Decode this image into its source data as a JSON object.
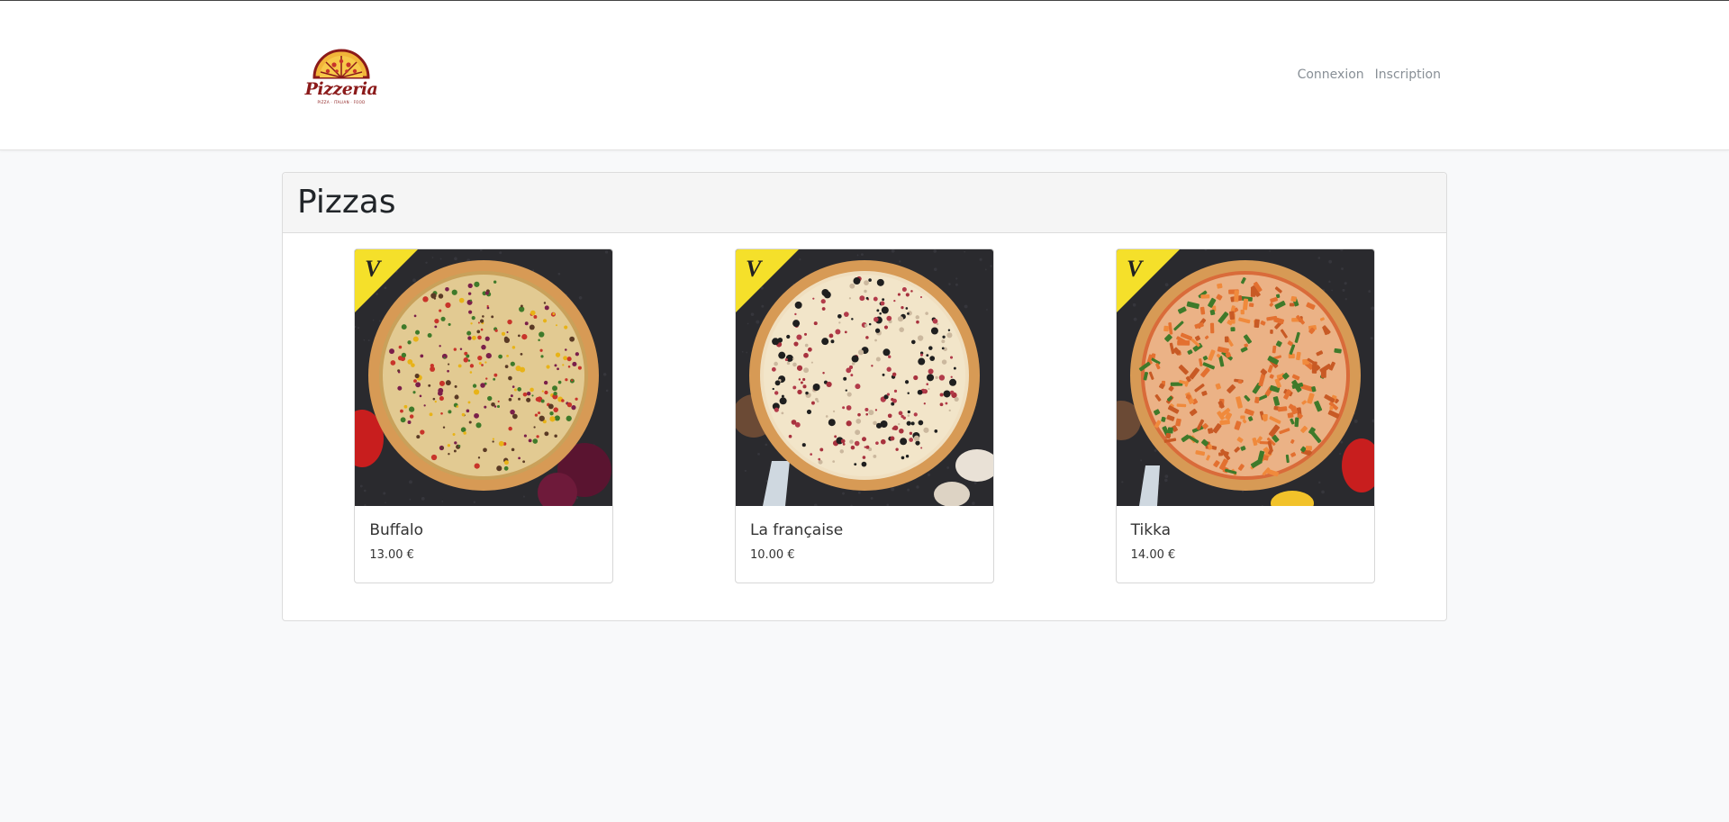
{
  "header": {
    "logo_text": "Pizzeria",
    "logo_sub": "PIZZA · ITALIAN · FOOD",
    "nav": [
      {
        "label": "Connexion"
      },
      {
        "label": "Inscription"
      }
    ]
  },
  "main": {
    "title": "Pizzas",
    "badge_letter": "V",
    "pizzas": [
      {
        "name": "Buffalo",
        "price": "13.00 €",
        "sauce": "#c9a15a",
        "cheese": "#e9d8a6",
        "toppings": [
          "#7a1f4a",
          "#e8b317",
          "#5a3a25",
          "#3f7a2a",
          "#c8342a"
        ]
      },
      {
        "name": "La française",
        "price": "10.00 €",
        "sauce": "#f0dfc0",
        "cheese": "#f3e7cc",
        "toppings": [
          "#b23b4a",
          "#cbb89e",
          "#1f1f1f",
          "#a8323e"
        ]
      },
      {
        "name": "Tikka",
        "price": "14.00 €",
        "sauce": "#d96b3a",
        "cheese": "#f0c9a0",
        "toppings": [
          "#e37030",
          "#f08a3c",
          "#3f7a2a",
          "#c85a25"
        ]
      }
    ]
  },
  "colors": {
    "badge": "#f5e02a",
    "board": "#2a2a2e",
    "crust": "#d79a55"
  }
}
